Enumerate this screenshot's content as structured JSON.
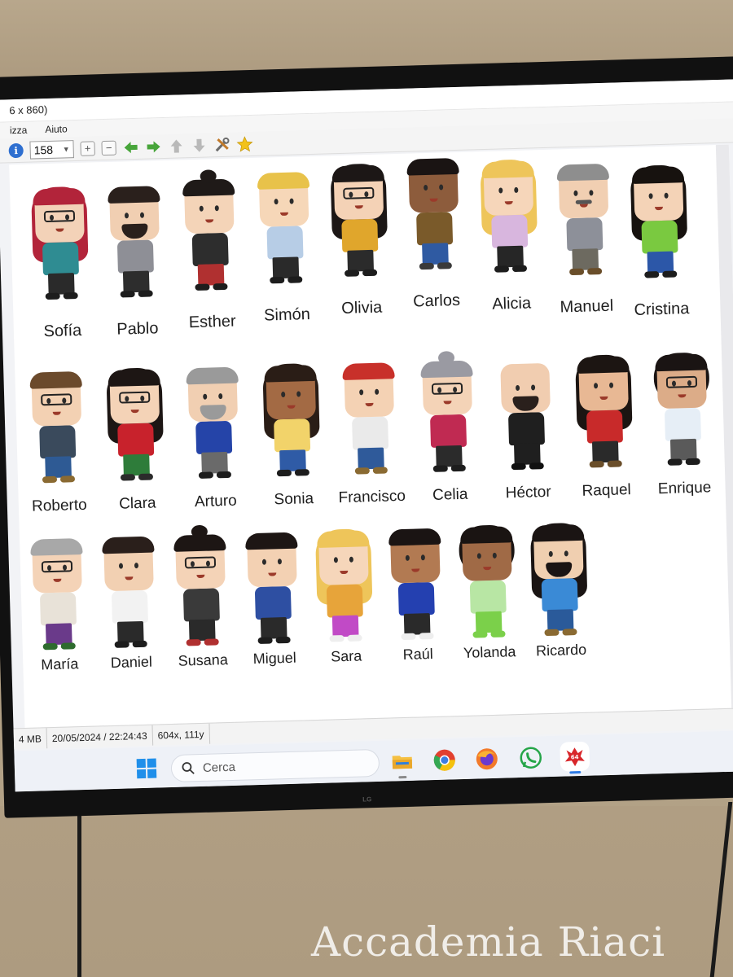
{
  "window": {
    "title_fragment": "6 x 860)"
  },
  "menu": {
    "items": [
      "izza",
      "Aiuto"
    ]
  },
  "toolbar": {
    "zoom_value": "158"
  },
  "characters": [
    {
      "name": "Sofía",
      "row": 1,
      "skin": "#f3d2b8",
      "hair": "#b2243a",
      "top": "#2f8c92",
      "pants": "#2a2a2a",
      "shoes": "#1d1d1d",
      "glasses": true,
      "hairstyle": "long"
    },
    {
      "name": "Pablo",
      "row": 1,
      "skin": "#f1cfb2",
      "hair": "#2a201c",
      "top": "#8e8f96",
      "pants": "#2d2d2d",
      "shoes": "#1d1d1d",
      "beard": true,
      "hairstyle": "short"
    },
    {
      "name": "Esther",
      "row": 1,
      "skin": "#f4d4b8",
      "hair": "#1f1a18",
      "top": "#2d2d2d",
      "pants": "#b03030",
      "shoes": "#1d1d1d",
      "hairstyle": "bun"
    },
    {
      "name": "Simón",
      "row": 1,
      "skin": "#f6d7b8",
      "hair": "#e8c24a",
      "top": "#b7cde6",
      "pants": "#2a2a2a",
      "shoes": "#1d1d1d",
      "hairstyle": "short"
    },
    {
      "name": "Olivia",
      "row": 1,
      "skin": "#f4d2b6",
      "hair": "#1c1716",
      "top": "#e0a62c",
      "pants": "#2b2b2b",
      "shoes": "#1d1d1d",
      "glasses": true,
      "hairstyle": "long"
    },
    {
      "name": "Carlos",
      "row": 1,
      "skin": "#8d5c3c",
      "hair": "#1a1413",
      "top": "#7a5a2a",
      "pants": "#2f5aa2",
      "shoes": "#3a3a3a",
      "hairstyle": "short"
    },
    {
      "name": "Alicia",
      "row": 1,
      "skin": "#f6d6ba",
      "hair": "#eec55a",
      "top": "#d8b6de",
      "pants": "#262626",
      "shoes": "#1d1d1d",
      "hairstyle": "long"
    },
    {
      "name": "Manuel",
      "row": 1,
      "skin": "#f1cfb2",
      "hair": "#8e8e8e",
      "top": "#8d9099",
      "pants": "#6d6a60",
      "shoes": "#6a4e2a",
      "mustache": true,
      "hairstyle": "short"
    },
    {
      "name": "Cristina",
      "row": 1,
      "skin": "#f4d3b7",
      "hair": "#17120f",
      "top": "#7ac940",
      "pants": "#2c57a8",
      "shoes": "#1d1d1d",
      "hairstyle": "long"
    },
    {
      "name": "Roberto",
      "row": 2,
      "skin": "#f3d1b3",
      "hair": "#6b4a2c",
      "top": "#3a4a5c",
      "pants": "#2e5a94",
      "shoes": "#8a6a32",
      "glasses": true,
      "hairstyle": "short"
    },
    {
      "name": "Clara",
      "row": 2,
      "skin": "#f4d3b7",
      "hair": "#1d1614",
      "top": "#c8222c",
      "pants": "#2e7c3a",
      "shoes": "#2b2b2b",
      "glasses": true,
      "hairstyle": "long"
    },
    {
      "name": "Arturo",
      "row": 2,
      "skin": "#f1cfb2",
      "hair": "#9a9a9a",
      "top": "#2544a8",
      "pants": "#6a6a6a",
      "shoes": "#1d1d1d",
      "beard": true,
      "hairstyle": "short"
    },
    {
      "name": "Sonia",
      "row": 2,
      "skin": "#a36a44",
      "hair": "#2a1d16",
      "top": "#f2d36a",
      "pants": "#2f5ba6",
      "shoes": "#1d1d1d",
      "hairstyle": "long"
    },
    {
      "name": "Francisco",
      "row": 2,
      "skin": "#f4d2b4",
      "hair": "#c8302a",
      "top": "#eaeaea",
      "pants": "#2f5a9a",
      "shoes": "#8a6a32",
      "hairstyle": "short"
    },
    {
      "name": "Celia",
      "row": 2,
      "skin": "#f4d3b7",
      "hair": "#9a9aa2",
      "top": "#c02a52",
      "pants": "#2b2b2b",
      "shoes": "#1d1d1d",
      "glasses": true,
      "hairstyle": "bun"
    },
    {
      "name": "Héctor",
      "row": 2,
      "skin": "#f1cdb0",
      "hair": "#f1cdb0",
      "top": "#1f1f1f",
      "pants": "#1f1f1f",
      "shoes": "#111111",
      "beard": true,
      "hairstyle": "bald"
    },
    {
      "name": "Raquel",
      "row": 2,
      "skin": "#e8b894",
      "hair": "#1c1512",
      "top": "#c82a2a",
      "pants": "#2a2a2a",
      "shoes": "#6a4e2a",
      "hairstyle": "long"
    },
    {
      "name": "Enrique",
      "row": 2,
      "skin": "#dcac88",
      "hair": "#1a1413",
      "top": "#e6eef6",
      "pants": "#5a5a5a",
      "shoes": "#1d1d1d",
      "glasses": true,
      "hairstyle": "curly"
    },
    {
      "name": "María",
      "row": 3,
      "skin": "#f4d3b7",
      "hair": "#a8a8a8",
      "top": "#e8e2d8",
      "pants": "#6a3a8a",
      "shoes": "#2e6b2e",
      "glasses": true,
      "hairstyle": "short"
    },
    {
      "name": "Daniel",
      "row": 3,
      "skin": "#f2d0b2",
      "hair": "#2a1f1b",
      "top": "#f2f2f2",
      "pants": "#2a2a2a",
      "shoes": "#1d1d1d",
      "hairstyle": "short"
    },
    {
      "name": "Susana",
      "row": 3,
      "skin": "#f4d3b7",
      "hair": "#1d1614",
      "top": "#3a3a3a",
      "pants": "#2a2a2a",
      "shoes": "#b03030",
      "glasses": true,
      "hairstyle": "bun"
    },
    {
      "name": "Miguel",
      "row": 3,
      "skin": "#f3d1b3",
      "hair": "#1d1614",
      "top": "#2e4fa2",
      "pants": "#2a2a2a",
      "shoes": "#1d1d1d",
      "hairstyle": "short"
    },
    {
      "name": "Sara",
      "row": 3,
      "skin": "#f6d6ba",
      "hair": "#eec55a",
      "top": "#e7a43a",
      "pants": "#c14ac6",
      "shoes": "#eeeeee",
      "hairstyle": "long"
    },
    {
      "name": "Raúl",
      "row": 3,
      "skin": "#b27a52",
      "hair": "#1a1413",
      "top": "#2440b0",
      "pants": "#2a2a2a",
      "shoes": "#eeeeee",
      "hairstyle": "short"
    },
    {
      "name": "Yolanda",
      "row": 3,
      "skin": "#a06a46",
      "hair": "#1a1412",
      "top": "#b8e6a4",
      "pants": "#7bd04a",
      "shoes": "#7bd04a",
      "hairstyle": "curly"
    },
    {
      "name": "Ricardo",
      "row": 3,
      "skin": "#f0cfb0",
      "hair": "#1a1413",
      "top": "#3a8ad6",
      "pants": "#2a5a9a",
      "shoes": "#8a6a32",
      "beard": true,
      "hairstyle": "long"
    }
  ],
  "statusbar": {
    "size": "4 MB",
    "datetime": "20/05/2024 / 22:24:43",
    "coords": "604x, 111y"
  },
  "taskbar": {
    "search_placeholder": "Cerca",
    "apps": [
      "file-explorer-icon",
      "chrome-icon",
      "firefox-icon",
      "whatsapp-icon",
      "irfanview-icon"
    ]
  },
  "watermark": "Accademia Riaci"
}
